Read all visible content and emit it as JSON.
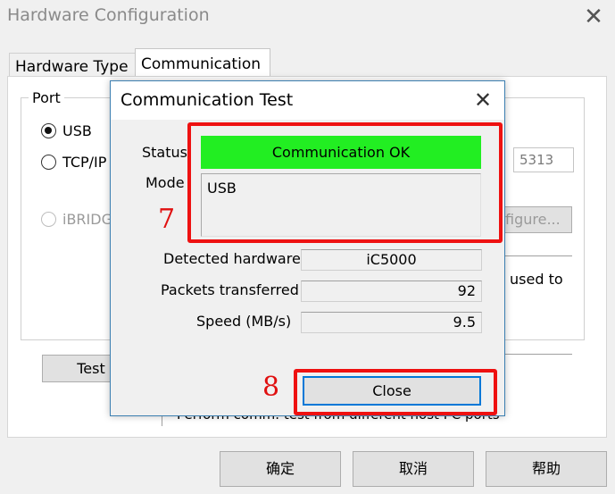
{
  "window": {
    "title": "Hardware Configuration"
  },
  "tabs": [
    {
      "label": "Hardware Type"
    },
    {
      "label": "Communication"
    }
  ],
  "port_group": {
    "label": "Port",
    "usb_label": "USB",
    "tcpip_label": "TCP/IP",
    "ibridge_label": "iBRIDG",
    "port_value": "5313",
    "configure_label": "figure...",
    "used_to_text": "used to"
  },
  "test_button": {
    "label": "Test"
  },
  "footer_text": "Perform comm. test from different host PC ports",
  "dialog": {
    "title": "Communication Test",
    "status_label": "Status",
    "status_value": "Communication OK",
    "status_color": "#22ee22",
    "mode_label": "Mode",
    "mode_value": "USB",
    "detected_label": "Detected hardware",
    "detected_value": "iC5000",
    "packets_label": "Packets transferred",
    "packets_value": "92",
    "speed_label": "Speed (MB/s)",
    "speed_value": "9.5",
    "close_label": "Close"
  },
  "annotations": {
    "highlight_color": "#ee1111",
    "label_1": "7",
    "label_2": "8"
  },
  "buttons": {
    "ok": "确定",
    "cancel": "取消",
    "help": "帮助"
  }
}
